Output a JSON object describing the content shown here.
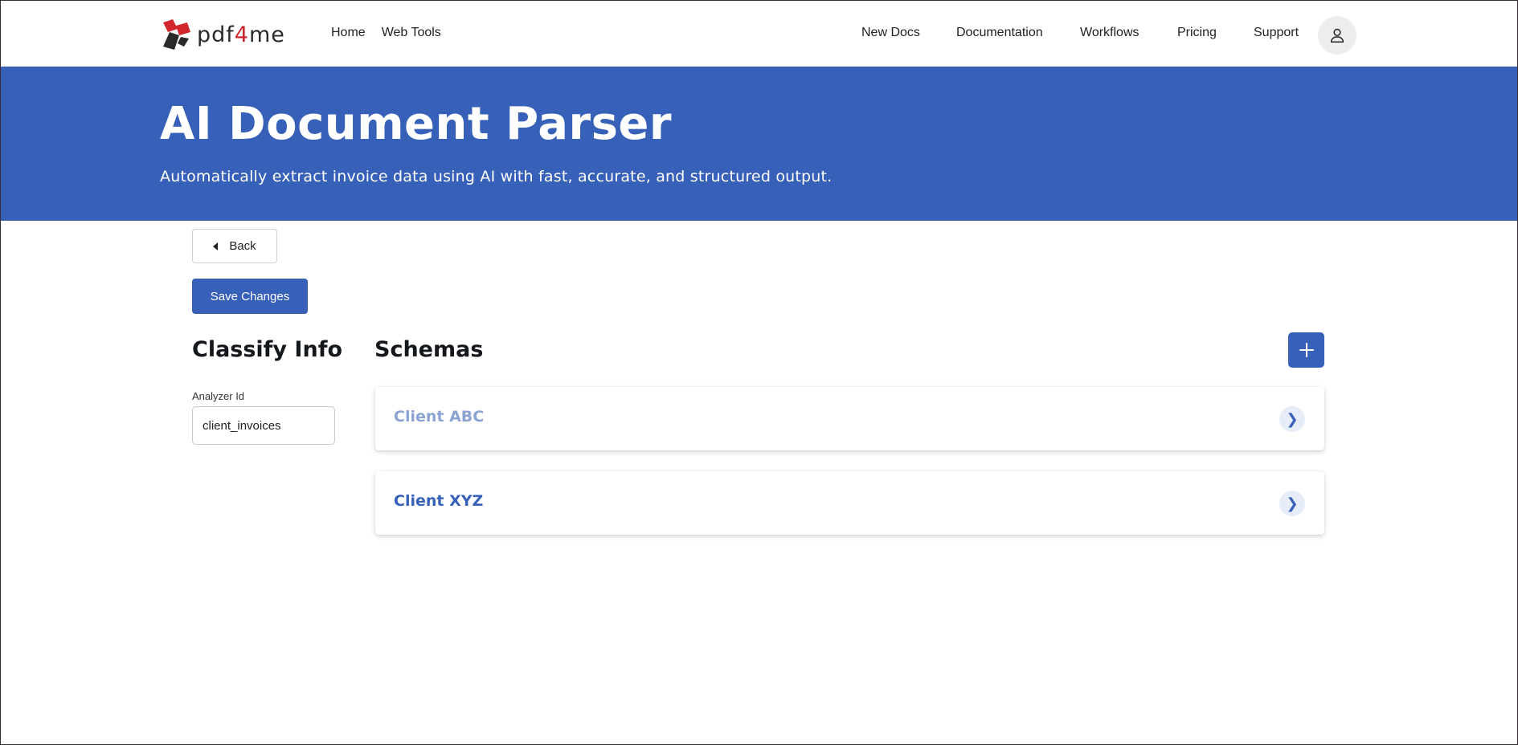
{
  "brand": {
    "logo_prefix": "pdf",
    "logo_four": "4",
    "logo_suffix": "me",
    "accent_color": "#3761b8",
    "logo_red": "#d1262c"
  },
  "nav": {
    "left": [
      "Home",
      "Web Tools"
    ],
    "right": [
      "New Docs",
      "Documentation",
      "Workflows",
      "Pricing",
      "Support"
    ],
    "account_icon": "user-icon"
  },
  "hero": {
    "title": "AI Document Parser",
    "subtitle": "Automatically extract invoice data using AI with fast, accurate, and structured output."
  },
  "actions": {
    "back_label": "Back",
    "save_label": "Save Changes"
  },
  "classify": {
    "title": "Classify Info",
    "analyzer_label": "Analyzer Id",
    "analyzer_value": "client_invoices"
  },
  "schemas": {
    "title": "Schemas",
    "add_icon": "plus-icon",
    "items": [
      {
        "name": "Client ABC",
        "icon": "chevron-right-icon",
        "glyph": "❯"
      },
      {
        "name": "Client XYZ",
        "icon": "chevron-right-icon",
        "glyph": "❯"
      }
    ]
  }
}
